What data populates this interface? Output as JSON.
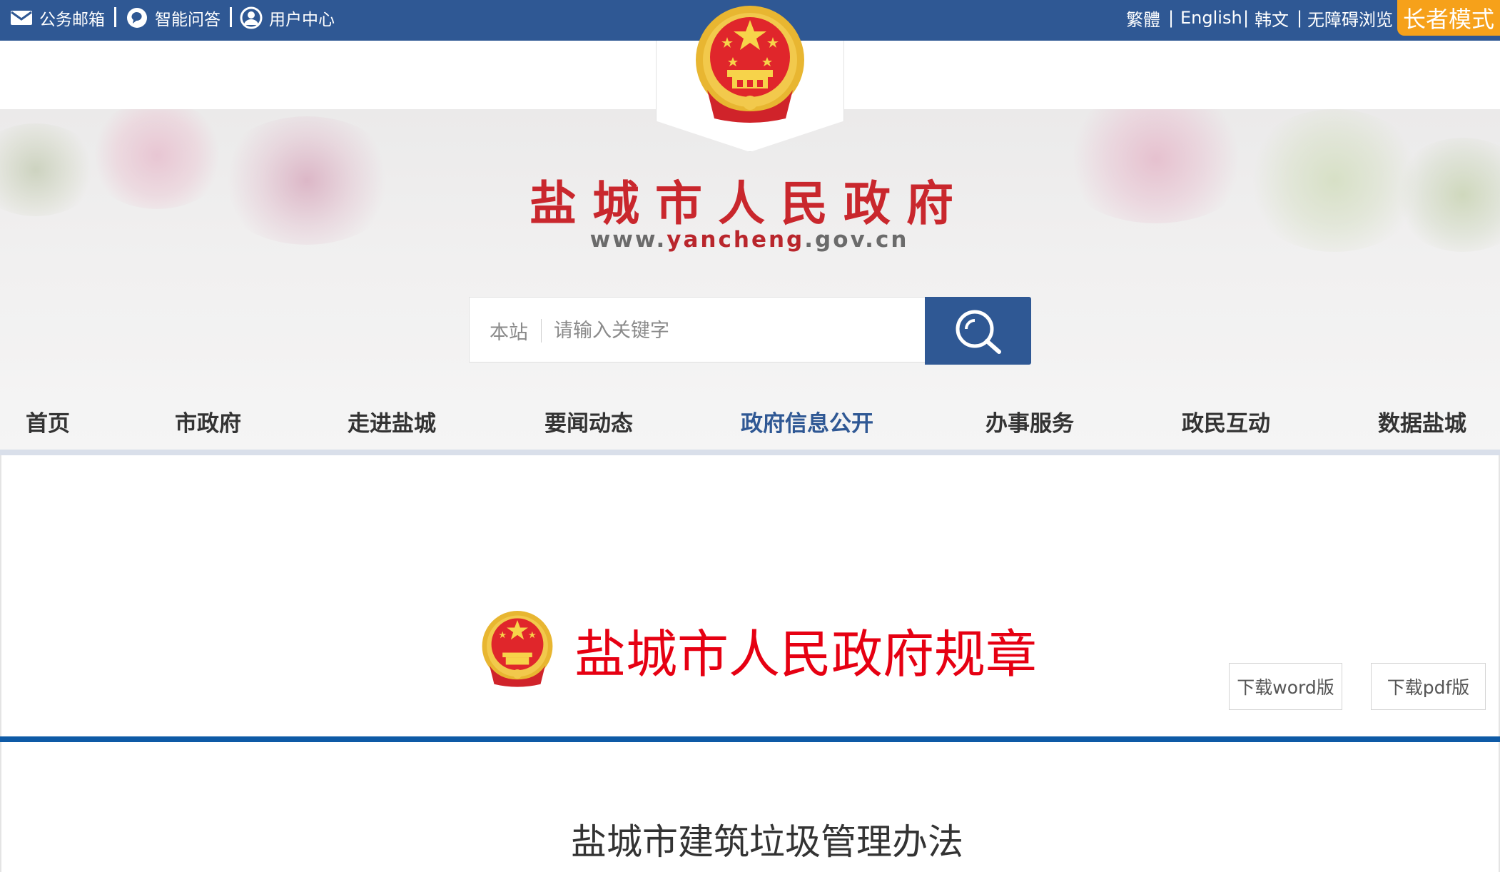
{
  "topbar": {
    "mail_label": "公务邮箱",
    "qa_label": "智能问答",
    "user_label": "用户中心",
    "lang_traditional": "繁體",
    "lang_english": "English",
    "lang_korean": "韩文",
    "accessible": "无障碍浏览",
    "elder_mode": "长者模式",
    "separator": "|"
  },
  "header": {
    "site_name": "盐城市人民政府",
    "url_prefix": "www.",
    "url_highlight": "yancheng",
    "url_suffix": ".gov.cn"
  },
  "search": {
    "scope": "本站",
    "placeholder": "请输入关键字"
  },
  "nav": {
    "items": [
      {
        "label": "首页"
      },
      {
        "label": "市政府"
      },
      {
        "label": "走进盐城"
      },
      {
        "label": "要闻动态"
      },
      {
        "label": "政府信息公开"
      },
      {
        "label": "办事服务"
      },
      {
        "label": "政民互动"
      },
      {
        "label": "数据盐城"
      }
    ],
    "active_index": 4
  },
  "document": {
    "series_title": "盐城市人民政府规章",
    "download_word": "下载word版",
    "download_pdf": "下载pdf版",
    "title": "盐城市建筑垃圾管理办法"
  },
  "colors": {
    "topbar": "#2f5894",
    "elder_button": "#f6a11a",
    "site_name": "#c9272d",
    "series_title": "#e60012",
    "rule": "#0e5aa6"
  },
  "icons": {
    "mail": "envelope-icon",
    "qa": "chat-bubble-icon",
    "user": "user-circle-icon",
    "search": "magnifier-icon",
    "emblem": "national-emblem-icon"
  }
}
